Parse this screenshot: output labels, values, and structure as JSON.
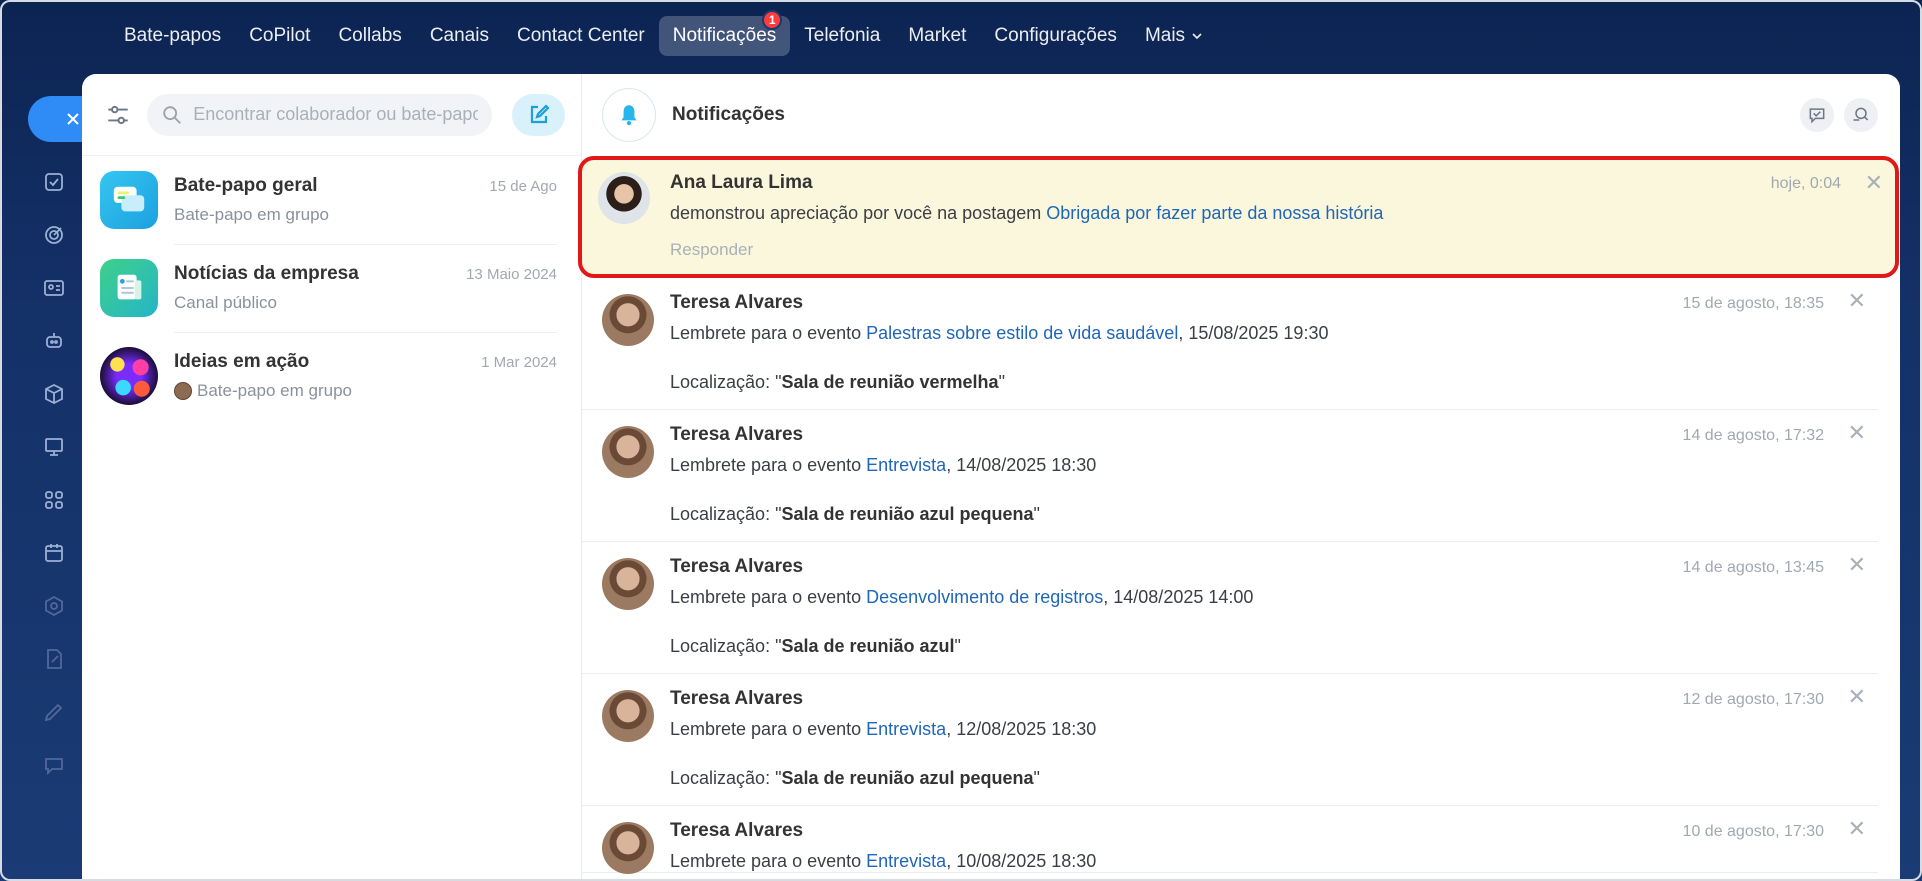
{
  "topnav": {
    "items": [
      {
        "label": "Bate-papos"
      },
      {
        "label": "CoPilot"
      },
      {
        "label": "Collabs"
      },
      {
        "label": "Canais"
      },
      {
        "label": "Contact Center"
      },
      {
        "label": "Notificações",
        "badge": "1",
        "active": true
      },
      {
        "label": "Telefonia"
      },
      {
        "label": "Market"
      },
      {
        "label": "Configurações"
      },
      {
        "label": "Mais"
      }
    ]
  },
  "rail": {
    "close_icon": "close-icon",
    "icons": [
      "checkbox-icon",
      "target-icon",
      "contact-card-icon",
      "robot-icon",
      "box-icon",
      "presentation-icon",
      "apps-icon",
      "calendar-grid-icon",
      "hexagon-icon",
      "document-edit-icon",
      "pen-icon",
      "chat-icon"
    ]
  },
  "sidebar": {
    "search": {
      "placeholder": "Encontrar colaborador ou bate-papo"
    },
    "chats": [
      {
        "name": "Bate-papo geral",
        "date": "15 de Ago",
        "subtitle": "Bate-papo em grupo"
      },
      {
        "name": "Notícias da empresa",
        "date": "13 Maio 2024",
        "subtitle": "Canal público"
      },
      {
        "name": "Ideias em ação",
        "date": "1 Mar 2024",
        "subtitle": "Bate-papo em grupo"
      }
    ]
  },
  "notifications": {
    "title": "Notificações",
    "items": [
      {
        "name": "Ana Laura Lima",
        "time": "hoje, 0:04",
        "text": "demonstrou apreciação por você na postagem ",
        "link": "Obrigada por fazer parte da nossa história",
        "text_after": "",
        "reply": "Responder"
      },
      {
        "name": "Teresa Alvares",
        "time": "15 de agosto, 18:35",
        "text": "Lembrete para o evento ",
        "link": "Palestras sobre estilo de vida saudável",
        "text_after": ", 15/08/2025 19:30",
        "loc_prefix": "Localização: \"",
        "loc": "Sala de reunião vermelha",
        "loc_suffix": "\""
      },
      {
        "name": "Teresa Alvares",
        "time": "14 de agosto, 17:32",
        "text": "Lembrete para o evento ",
        "link": "Entrevista",
        "text_after": ", 14/08/2025 18:30",
        "loc_prefix": "Localização: \"",
        "loc": "Sala de reunião azul pequena",
        "loc_suffix": "\""
      },
      {
        "name": "Teresa Alvares",
        "time": "14 de agosto, 13:45",
        "text": "Lembrete para o evento ",
        "link": "Desenvolvimento de registros",
        "text_after": ", 14/08/2025 14:00",
        "loc_prefix": "Localização: \"",
        "loc": "Sala de reunião azul",
        "loc_suffix": "\""
      },
      {
        "name": "Teresa Alvares",
        "time": "12 de agosto, 17:30",
        "text": "Lembrete para o evento ",
        "link": "Entrevista",
        "text_after": ", 12/08/2025 18:30",
        "loc_prefix": "Localização: \"",
        "loc": "Sala de reunião azul pequena",
        "loc_suffix": "\""
      },
      {
        "name": "Teresa Alvares",
        "time": "10 de agosto, 17:30",
        "text": "Lembrete para o evento ",
        "link": "Entrevista",
        "text_after": ", 10/08/2025 18:30"
      }
    ]
  }
}
